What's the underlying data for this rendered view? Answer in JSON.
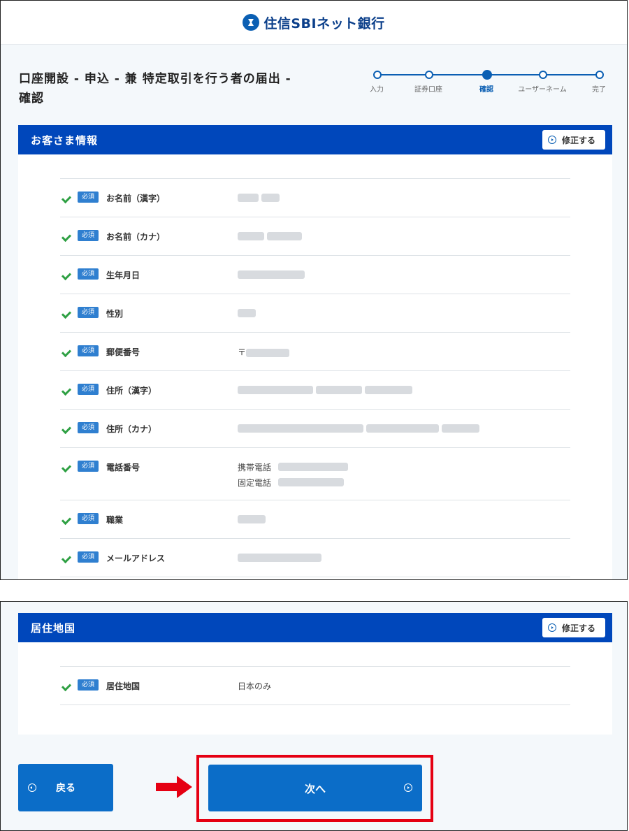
{
  "header": {
    "brand": "住信SBIネット銀行"
  },
  "page": {
    "title": "口座開設 - 申込 - 兼 特定取引を行う者の届出 - 確認"
  },
  "stepper": {
    "steps": [
      {
        "label": "入力",
        "state": "done"
      },
      {
        "label": "証券口座",
        "state": "done"
      },
      {
        "label": "確認",
        "state": "current"
      },
      {
        "label": "ユーザーネーム",
        "state": "todo"
      },
      {
        "label": "完了",
        "state": "todo"
      }
    ]
  },
  "customer_panel": {
    "title": "お客さま情報",
    "edit_label": "修正する",
    "required_badge": "必須",
    "fields": [
      {
        "label": "お名前（漢字）",
        "value": ""
      },
      {
        "label": "お名前（カナ）",
        "value": ""
      },
      {
        "label": "生年月日",
        "value": ""
      },
      {
        "label": "性別",
        "value": ""
      },
      {
        "label": "郵便番号",
        "value": "〒"
      },
      {
        "label": "住所（漢字）",
        "value": ""
      },
      {
        "label": "住所（カナ）",
        "value": ""
      },
      {
        "label": "電話番号",
        "mobile_label": "携帯電話",
        "landline_label": "固定電話"
      },
      {
        "label": "職業",
        "value": ""
      },
      {
        "label": "メールアドレス",
        "value": ""
      }
    ]
  },
  "residence_panel": {
    "title": "居住地国",
    "edit_label": "修正する",
    "required_badge": "必須",
    "fields": [
      {
        "label": "居住地国",
        "value": "日本のみ"
      }
    ]
  },
  "buttons": {
    "back_label": "戻る",
    "next_label": "次へ"
  },
  "colors": {
    "brand_blue": "#0047bb",
    "button_blue": "#0b6dc8",
    "highlight_red": "#e50012",
    "check_green": "#2ea043"
  }
}
